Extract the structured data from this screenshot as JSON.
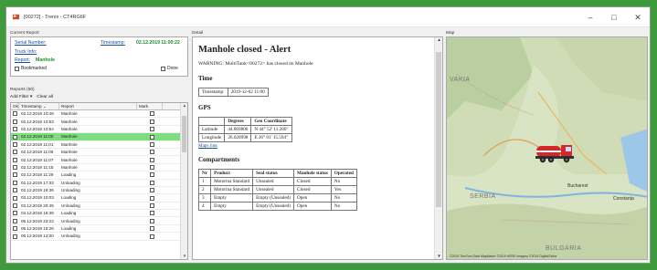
{
  "window": {
    "title": "[00272] - Trenix - CT4RG6F"
  },
  "current_report": {
    "panel_title": "Current Report",
    "serial_label": "Serial Number:",
    "timestamp_label": "Timestamp:",
    "timestamp_value": "02.12.2019 11:00:22",
    "truck_label": "Truck Info:",
    "report_label": "Report:",
    "report_value": "Manhole",
    "bookmarked_label": "Bookmarked",
    "done_label": "Done"
  },
  "reports": {
    "panel_title": "Reports (50)",
    "add_filter": "Add Filter",
    "clear_all": "Clear all",
    "columns": {
      "ok": "Ok",
      "timestamp": "Timestamp",
      "report": "Report",
      "mark": "Mark"
    },
    "rows": [
      {
        "ts": "02.12.2019 10:46",
        "rep": "Manhole"
      },
      {
        "ts": "02.12.2019 10:53",
        "rep": "Manhole"
      },
      {
        "ts": "02.12.2019 10:54",
        "rep": "Manhole"
      },
      {
        "ts": "02.12.2019 11:00",
        "rep": "Manhole"
      },
      {
        "ts": "02.12.2019 11:01",
        "rep": "Manhole"
      },
      {
        "ts": "02.12.2019 11:06",
        "rep": "Manhole"
      },
      {
        "ts": "02.12.2019 11:07",
        "rep": "Manhole"
      },
      {
        "ts": "02.12.2019 11:15",
        "rep": "Manhole"
      },
      {
        "ts": "02.12.2019 11:29",
        "rep": "Loading"
      },
      {
        "ts": "02.12.2019 17:33",
        "rep": "Unloading"
      },
      {
        "ts": "02.12.2019 18:36",
        "rep": "Unloading"
      },
      {
        "ts": "03.12.2019 10:03",
        "rep": "Loading"
      },
      {
        "ts": "03.12.2019 20:45",
        "rep": "Unloading"
      },
      {
        "ts": "04.12.2019 16:38",
        "rep": "Loading"
      },
      {
        "ts": "05.12.2019 22:22",
        "rep": "Unloading"
      },
      {
        "ts": "05.12.2019 16:26",
        "rep": "Loading"
      },
      {
        "ts": "06.12.2019 12:00",
        "rep": "Unloading"
      }
    ]
  },
  "detail": {
    "panel_title": "Detail",
    "heading": "Manhole closed - Alert",
    "warning": "WARNING: MultiTank<00272> has closed its Manhole",
    "time_heading": "Time",
    "time_label": "Timestamp:",
    "time_value": "2019-12-02 11:00",
    "gps_heading": "GPS",
    "gps_cols": {
      "degrees": "Degrees",
      "geo": "Geo Coordinate"
    },
    "gps_rows": [
      {
        "label": "Latitude",
        "deg": "44.869800",
        "geo": "N 44° 52' 11.280\""
      },
      {
        "label": "Longitude",
        "deg": "26.020998",
        "geo": "E 26° 01' 15.594\""
      }
    ],
    "maps_link": "Maps link",
    "compartments_heading": "Compartments",
    "comp_cols": {
      "nr": "Nr",
      "product": "Product",
      "seal": "Seal status",
      "manhole": "Manhole status",
      "operated": "Operated"
    },
    "comp_rows": [
      {
        "nr": "1",
        "product": "Motorina Standard",
        "seal": "Unsealed",
        "manhole": "Closed",
        "operated": "No"
      },
      {
        "nr": "2",
        "product": "Motorina Standard",
        "seal": "Unsealed",
        "manhole": "Closed",
        "operated": "Yes"
      },
      {
        "nr": "3",
        "product": "Empty",
        "seal": "Empty (Unsealed)",
        "manhole": "Open",
        "operated": "No"
      },
      {
        "nr": "4",
        "product": "Empty",
        "seal": "Empty (Unsealed)",
        "manhole": "Open",
        "operated": "No"
      }
    ]
  },
  "map": {
    "panel_title": "Map",
    "labels": [
      "VAKIA",
      "SERBIA",
      "BULGARIA",
      "Bucharest",
      "Constanța"
    ],
    "attribution": "©2019 TomTom  Data MapMaker ©2019 HERE  Imagery ©2019 DigitalGlobe"
  }
}
